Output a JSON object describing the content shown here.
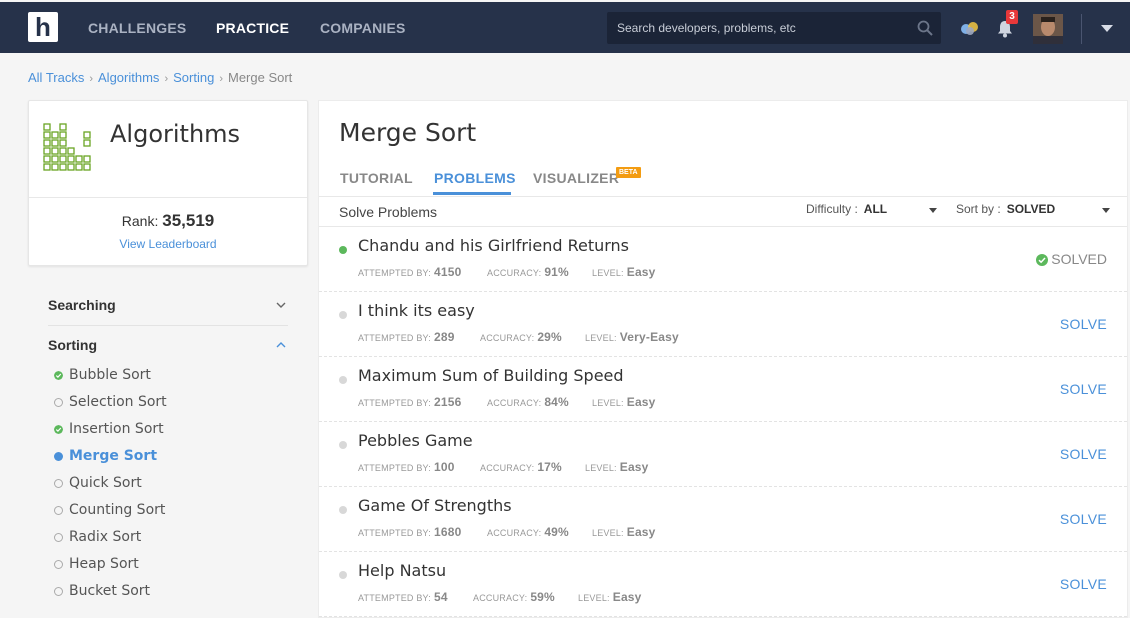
{
  "nav": {
    "logo_letter": "h",
    "links": [
      "CHALLENGES",
      "PRACTICE",
      "COMPANIES"
    ],
    "active": "PRACTICE",
    "search_placeholder": "Search developers, problems, etc",
    "notification_count": "3"
  },
  "breadcrumb": [
    "All Tracks",
    "Algorithms",
    "Sorting",
    "Merge Sort"
  ],
  "track": {
    "title": "Algorithms",
    "rank_label": "Rank:",
    "rank_value": "35,519",
    "leaderboard_link": "View Leaderboard"
  },
  "sidebar": {
    "sections": [
      {
        "label": "Searching",
        "expanded": false
      },
      {
        "label": "Sorting",
        "expanded": true
      }
    ],
    "sort_items": [
      {
        "label": "Bubble Sort",
        "status": "solved"
      },
      {
        "label": "Selection Sort",
        "status": "open"
      },
      {
        "label": "Insertion Sort",
        "status": "solved"
      },
      {
        "label": "Merge Sort",
        "status": "active"
      },
      {
        "label": "Quick Sort",
        "status": "open"
      },
      {
        "label": "Counting Sort",
        "status": "open"
      },
      {
        "label": "Radix Sort",
        "status": "open"
      },
      {
        "label": "Heap Sort",
        "status": "open"
      },
      {
        "label": "Bucket Sort",
        "status": "open"
      }
    ]
  },
  "main": {
    "title": "Merge Sort",
    "tabs": [
      "TUTORIAL",
      "PROBLEMS",
      "VISUALIZER"
    ],
    "active_tab": "PROBLEMS",
    "beta_badge": "BETA",
    "solve_heading": "Solve Problems",
    "difficulty_label": "Difficulty :",
    "difficulty_value": "ALL",
    "sort_label": "Sort by :",
    "sort_value": "SOLVED",
    "meta_labels": {
      "attempted": "Attempted by:",
      "accuracy": "Accuracy:",
      "level": "Level:"
    },
    "problems": [
      {
        "title": "Chandu and his Girlfriend Returns",
        "attempted": "4150",
        "accuracy": "91%",
        "level": "Easy",
        "action": "SOLVED",
        "solved": true
      },
      {
        "title": "I think its easy",
        "attempted": "289",
        "accuracy": "29%",
        "level": "Very-Easy",
        "action": "SOLVE",
        "solved": false
      },
      {
        "title": "Maximum Sum of Building Speed",
        "attempted": "2156",
        "accuracy": "84%",
        "level": "Easy",
        "action": "SOLVE",
        "solved": false
      },
      {
        "title": "Pebbles Game",
        "attempted": "100",
        "accuracy": "17%",
        "level": "Easy",
        "action": "SOLVE",
        "solved": false
      },
      {
        "title": "Game Of Strengths",
        "attempted": "1680",
        "accuracy": "49%",
        "level": "Easy",
        "action": "SOLVE",
        "solved": false
      },
      {
        "title": "Help Natsu",
        "attempted": "54",
        "accuracy": "59%",
        "level": "Easy",
        "action": "SOLVE",
        "solved": false
      }
    ]
  },
  "colors": {
    "nav_bg": "#26324a",
    "accent_blue": "#4a90d9",
    "solved_green": "#5cb85c",
    "track_green": "#6aa524",
    "beta_orange": "#f39c12",
    "badge_red": "#e8383a"
  }
}
